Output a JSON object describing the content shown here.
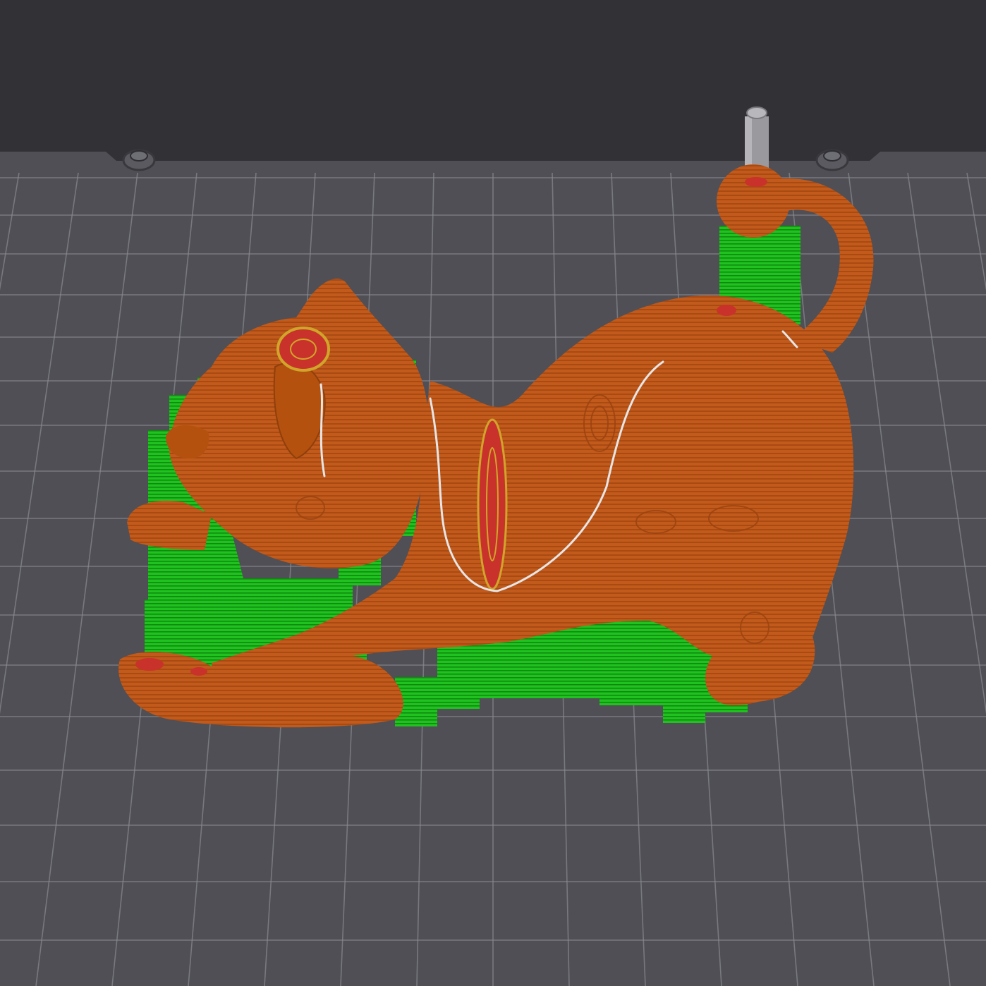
{
  "viewport": {
    "background_color": "#323236",
    "bed_color": "#4f4f55",
    "bed_grid_color": "#8a8a92"
  },
  "model": {
    "subject": "cat",
    "body_color": "#c25a1b",
    "support_color": "#19b819",
    "overhang_color": "#c8322a",
    "seam_color": "#e6e6e6"
  },
  "icons": [
    "bed-screw-left-icon",
    "bed-screw-right-icon",
    "wipe-tower-icon"
  ]
}
